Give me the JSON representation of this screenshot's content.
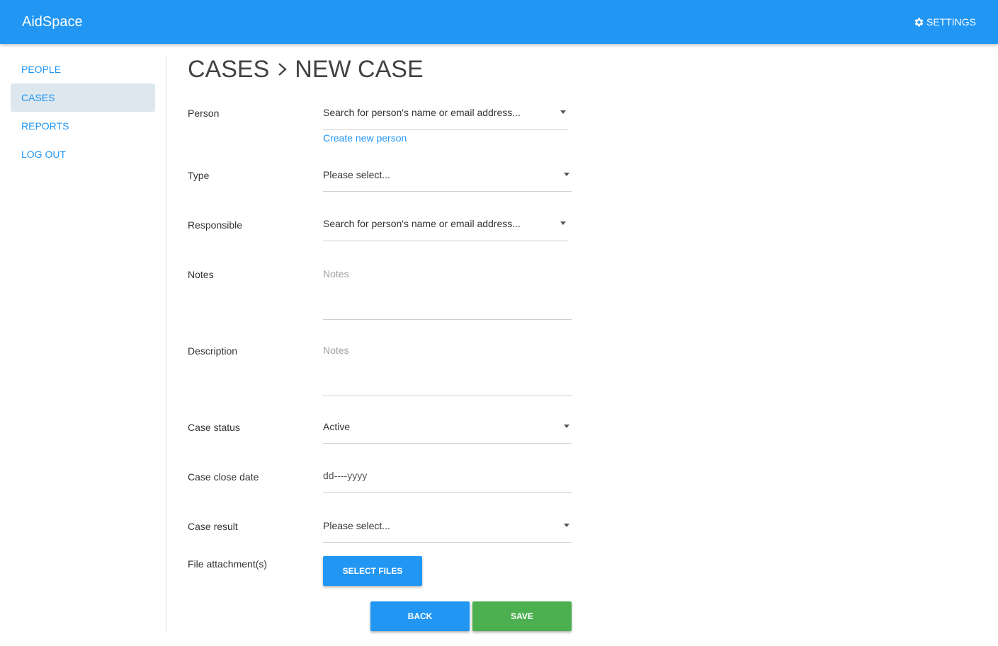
{
  "app": {
    "brand": "AidSpace",
    "settings_label": "SETTINGS"
  },
  "sidebar": {
    "items": [
      {
        "label": "PEOPLE"
      },
      {
        "label": "CASES",
        "active": true
      },
      {
        "label": "REPORTS"
      },
      {
        "label": "LOG OUT"
      }
    ]
  },
  "page": {
    "breadcrumb_parent": "CASES",
    "breadcrumb_current": "NEW CASE"
  },
  "form": {
    "person": {
      "label": "Person",
      "placeholder": "Search for person's name or email address...",
      "create_link": "Create new person"
    },
    "type": {
      "label": "Type",
      "value": "Please select..."
    },
    "responsible": {
      "label": "Responsible",
      "placeholder": "Search for person's name or email address..."
    },
    "notes": {
      "label": "Notes",
      "placeholder": "Notes"
    },
    "description": {
      "label": "Description",
      "placeholder": "Notes"
    },
    "case_status": {
      "label": "Case status",
      "value": "Active"
    },
    "case_close_date": {
      "label": "Case close date",
      "placeholder": "dd----yyyy"
    },
    "case_result": {
      "label": "Case result",
      "value": "Please select..."
    },
    "attachments": {
      "label": "File attachment(s)",
      "button": "SELECT FILES"
    }
  },
  "actions": {
    "back": "BACK",
    "save": "SAVE"
  },
  "colors": {
    "primary": "#2196f3",
    "success": "#4caf50",
    "nav_active_bg": "#dde7ee"
  }
}
